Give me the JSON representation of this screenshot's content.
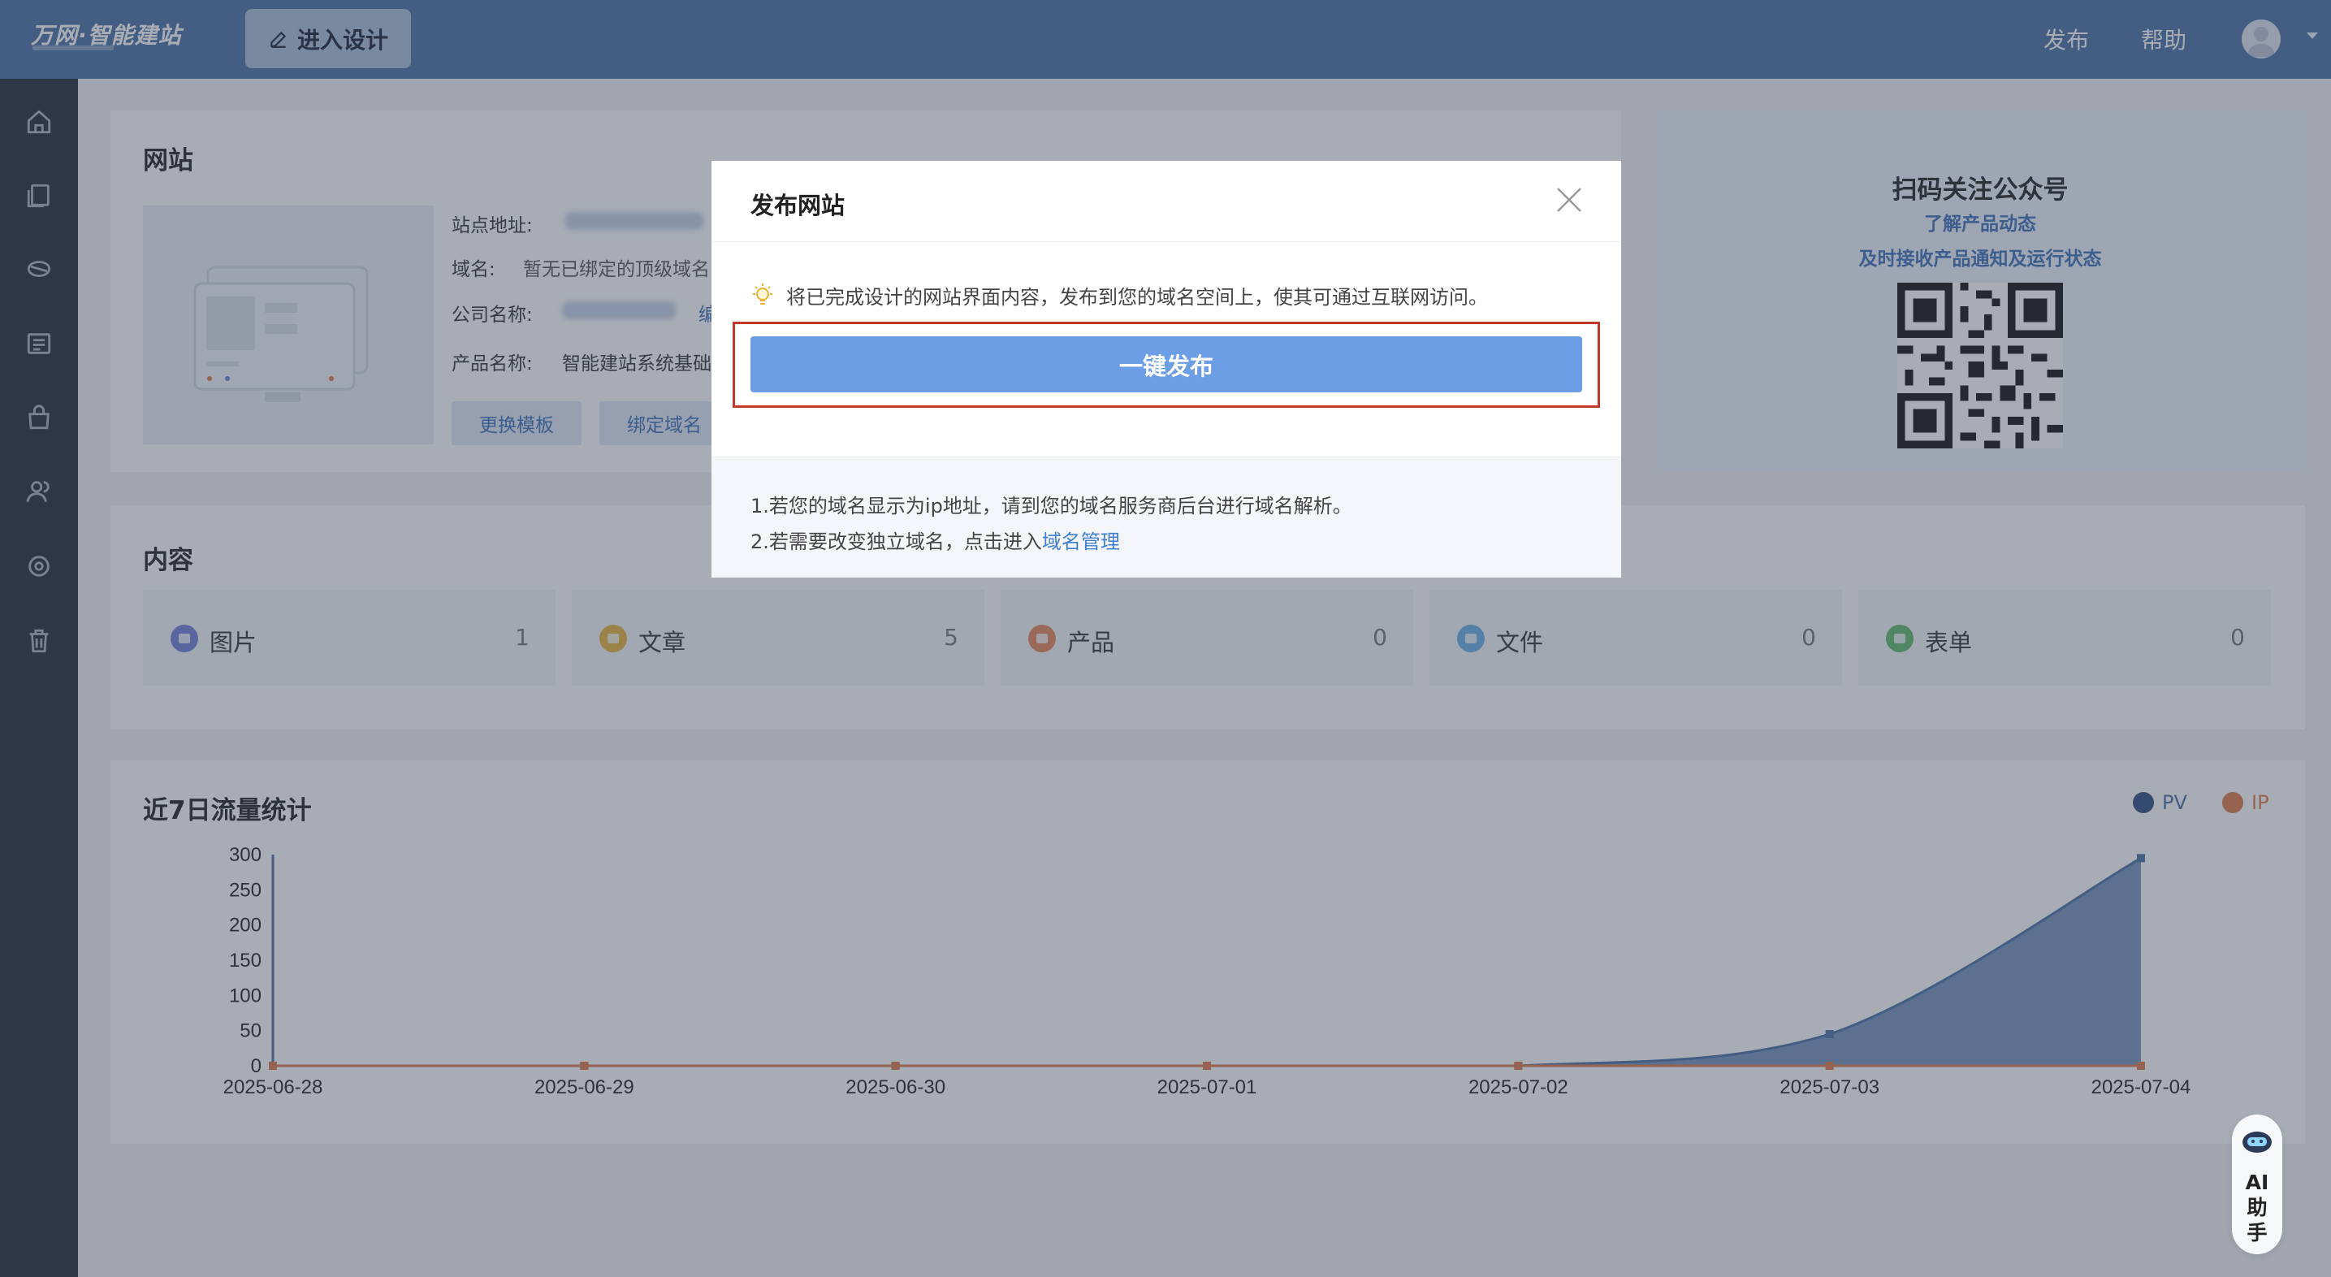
{
  "topbar": {
    "logo": "万网·智能建站",
    "design_button": "进入设计",
    "publish": "发布",
    "help": "帮助"
  },
  "sidebar": {
    "items": [
      "home-icon",
      "pages-icon",
      "design-icon",
      "list-icon",
      "shop-icon",
      "users-icon",
      "settings-icon",
      "trash-icon"
    ]
  },
  "website": {
    "title": "网站",
    "site_address_label": "站点地址:",
    "domain_label": "域名:",
    "domain_value": "暂无已绑定的顶级域名",
    "company_label": "公司名称:",
    "company_edit": "编",
    "product_label": "产品名称:",
    "product_value": "智能建站系统基础",
    "change_template": "更换模板",
    "bind_domain": "绑定域名"
  },
  "qr": {
    "title": "扫码关注公众号",
    "line1": "了解产品动态",
    "line2": "及时接收产品通知及运行状态"
  },
  "content": {
    "title": "内容",
    "items": [
      {
        "label": "图片",
        "count": "1",
        "color": "#6f7fd8"
      },
      {
        "label": "文章",
        "count": "5",
        "color": "#e7b33b"
      },
      {
        "label": "产品",
        "count": "0",
        "color": "#e7865a"
      },
      {
        "label": "文件",
        "count": "0",
        "color": "#6bb0e6"
      },
      {
        "label": "表单",
        "count": "0",
        "color": "#62bb6b"
      }
    ]
  },
  "traffic": {
    "title": "近7日流量统计",
    "legend_pv": "PV",
    "legend_ip": "IP"
  },
  "chart_data": {
    "type": "area",
    "x": [
      "2025-06-28",
      "2025-06-29",
      "2025-06-30",
      "2025-07-01",
      "2025-07-02",
      "2025-07-03",
      "2025-07-04"
    ],
    "series": [
      {
        "name": "PV",
        "values": [
          0,
          0,
          0,
          0,
          0,
          45,
          295
        ],
        "color": "#4a6fa5"
      },
      {
        "name": "IP",
        "values": [
          0,
          0,
          0,
          0,
          0,
          0,
          0
        ],
        "color": "#e07a4a"
      }
    ],
    "yticks": [
      "0",
      "50",
      "100",
      "150",
      "200",
      "250",
      "300"
    ],
    "ylim": [
      0,
      300
    ],
    "legend": "top-right"
  },
  "modal": {
    "title": "发布网站",
    "hint": "将已完成设计的网站界面内容，发布到您的域名空间上，使其可通过互联网访问。",
    "publish_button": "一键发布",
    "note1": "1.若您的域名显示为ip地址，请到您的域名服务商后台进行域名解析。",
    "note2_prefix": "2.若需要改变独立域名，点击进入",
    "note2_link": "域名管理"
  },
  "ai_helper": {
    "line1": "AI",
    "line2": "助",
    "line3": "手"
  }
}
